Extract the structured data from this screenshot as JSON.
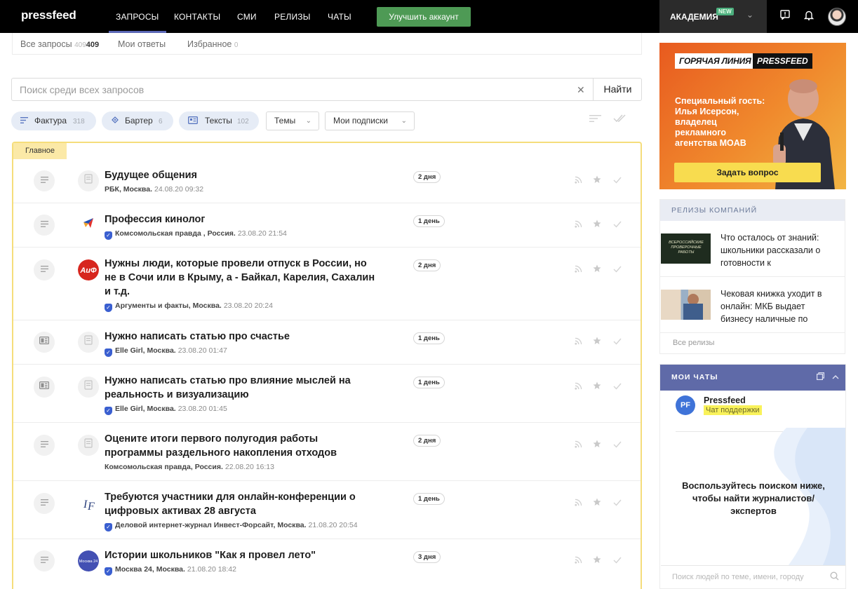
{
  "header": {
    "logo": "pressfeed",
    "nav": [
      {
        "label": "ЗАПРОСЫ",
        "active": true
      },
      {
        "label": "КОНТАКТЫ",
        "active": false
      },
      {
        "label": "СМИ",
        "active": false
      },
      {
        "label": "РЕЛИЗЫ",
        "active": false
      },
      {
        "label": "ЧАТЫ",
        "active": false
      }
    ],
    "upgrade_label": "Улучшить аккаунт",
    "academy_label": "АКАДЕМИЯ",
    "academy_badge": "NEW",
    "icons": [
      "feedback-icon",
      "bell-icon",
      "user-avatar"
    ]
  },
  "tabs": {
    "all_label": "Все запросы",
    "all_count_light": "409",
    "all_count_bold": "409",
    "my_answers_label": "Мои ответы",
    "favorites_label": "Избранное",
    "favorites_count": "0"
  },
  "search": {
    "placeholder": "Поиск среди всех запросов",
    "clear_icon": "close-icon",
    "button_label": "Найти"
  },
  "filters": {
    "chips": [
      {
        "label": "Фактура",
        "count": "318",
        "icon": "list-icon"
      },
      {
        "label": "Бартер",
        "count": "6",
        "icon": "gift-icon"
      },
      {
        "label": "Тексты",
        "count": "102",
        "icon": "card-icon"
      }
    ],
    "dropdowns": [
      {
        "label": "Темы"
      },
      {
        "label": "Мои подписки"
      }
    ]
  },
  "list": {
    "section_badge": "Главное",
    "requests": [
      {
        "title": "Будущее общения",
        "media": "РБК, Москва.",
        "date": "24.08.20 09:32",
        "verified": false,
        "age": "2 дня",
        "type_icon": "text-lines-icon",
        "logo": "placeholder"
      },
      {
        "title": "Профессия кинолог",
        "media": "Комсомольская правда , Россия.",
        "date": "23.08.20 21:54",
        "verified": true,
        "age": "1 день",
        "type_icon": "text-lines-icon",
        "logo": "kp"
      },
      {
        "title": "Нужны люди, которые провели отпуск в России, но не в Сочи или в Крыму, а - Байкал, Карелия, Сахалин и т.д.",
        "media": "Аргументы и факты, Москва.",
        "date": "23.08.20 20:24",
        "verified": true,
        "age": "2 дня",
        "type_icon": "text-lines-icon",
        "logo": "aif"
      },
      {
        "title": "Нужно написать статью про счастье",
        "media": "Elle Girl, Москва.",
        "date": "23.08.20 01:47",
        "verified": true,
        "age": "1 день",
        "type_icon": "article-icon",
        "logo": "placeholder"
      },
      {
        "title": "Нужно написать статью про влияние мыслей на реальность и визуализацию",
        "media": "Elle Girl, Москва.",
        "date": "23.08.20 01:45",
        "verified": true,
        "age": "1 день",
        "type_icon": "article-icon",
        "logo": "placeholder"
      },
      {
        "title": "Оцените итоги первого полугодия работы программы раздельного накопления отходов",
        "media": "Комсомольская правда, Россия.",
        "date": "22.08.20 16:13",
        "verified": false,
        "age": "2 дня",
        "type_icon": "text-lines-icon",
        "logo": "placeholder"
      },
      {
        "title": "Требуются участники для онлайн-конференции о цифровых активах 28 августа",
        "media": "Деловой интернет-журнал Инвест-Форсайт, Москва.",
        "date": "21.08.20 20:54",
        "verified": true,
        "age": "1 день",
        "type_icon": "text-lines-icon",
        "logo": "if"
      },
      {
        "title": "Истории школьников \"Как я провел лето\"",
        "media": "Москва 24, Москва.",
        "date": "21.08.20 18:42",
        "verified": true,
        "age": "3 дня",
        "type_icon": "text-lines-icon",
        "logo": "m24"
      }
    ]
  },
  "promo": {
    "tag_left": "ГОРЯЧАЯ ЛИНИЯ",
    "tag_right": "PRESSFEED",
    "text": "Специальный гость:\nИлья Исерсон,\nвладелец\nрекламного\nагентства MOAB",
    "button_label": "Задать вопрос"
  },
  "releases": {
    "heading": "РЕЛИЗЫ КОМПАНИЙ",
    "items": [
      {
        "title": "Что осталось от знаний: школьники рассказали о готовности к",
        "thumb_text": "ВСЕРОССИЙСКИЕ ПРОВЕРОЧНЫЕ РАБОТЫ"
      },
      {
        "title": "Чековая книжка уходит в онлайн: МКБ выдает бизнесу наличные по",
        "thumb_text": ""
      }
    ],
    "all_label": "Все релизы"
  },
  "chats": {
    "heading": "МОИ ЧАТЫ",
    "contact_initials": "PF",
    "contact_name": "Pressfeed",
    "contact_sub": "Чат поддержки",
    "empty_text": "Воспользуйтесь поиском ниже, чтобы найти журналистов/ экспертов",
    "search_placeholder": "Поиск людей по теме, имени, городу"
  },
  "colors": {
    "nav_bg": "#000000",
    "accent": "#5b67b6",
    "upgrade": "#4e9a55",
    "highlight_border": "#f5dd7b",
    "chip_bg": "#e6ecf6",
    "verify": "#3a5fd0"
  }
}
